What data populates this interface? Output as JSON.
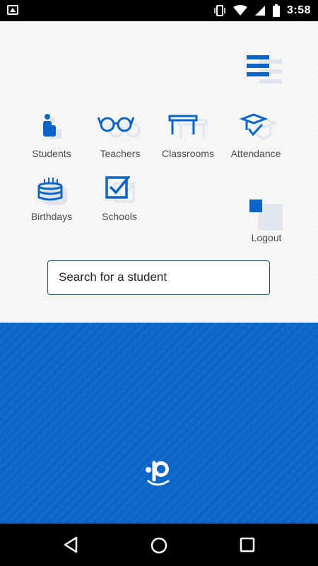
{
  "status_bar": {
    "time": "3:58",
    "left_icon": "image-icon",
    "icons": [
      "vibrate-icon",
      "wifi-icon",
      "signal-icon",
      "battery-icon"
    ]
  },
  "menu": {
    "icon": "hamburger-menu-icon"
  },
  "nav_tiles": [
    {
      "label": "Students",
      "icon": "students-icon"
    },
    {
      "label": "Teachers",
      "icon": "glasses-icon"
    },
    {
      "label": "Classrooms",
      "icon": "desk-icon"
    },
    {
      "label": "Attendance",
      "icon": "graduation-cap-check-icon"
    },
    {
      "label": "Birthdays",
      "icon": "birthday-cake-icon"
    },
    {
      "label": "Schools",
      "icon": "checkbox-icon"
    }
  ],
  "logout": {
    "label": "Logout",
    "icon": "logout-icon"
  },
  "search": {
    "placeholder": "Search for a student",
    "value": ""
  },
  "brand": {
    "logo": "p-smile-logo"
  },
  "colors": {
    "accent": "#0b65c8",
    "text": "#4b4b4b",
    "background": "#f7f7f5"
  },
  "nav_bar": {
    "buttons": [
      "back-icon",
      "home-icon",
      "recents-icon"
    ]
  }
}
